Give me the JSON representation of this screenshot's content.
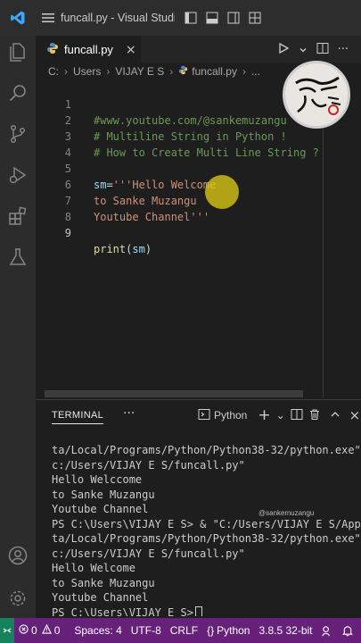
{
  "titlebar": {
    "app_icon": "vscode-logo-icon",
    "menu_icon": "hamburger-menu-icon",
    "title": "funcall.py - Visual Studi..."
  },
  "activity_bar": {
    "items": [
      "explorer-icon",
      "search-icon",
      "source-control-icon",
      "run-debug-icon",
      "extensions-icon",
      "testing-icon"
    ],
    "bottom": [
      "accounts-icon",
      "manage-gear-icon"
    ]
  },
  "tab": {
    "icon": "python-file-icon",
    "label": "funcall.py",
    "close": "×"
  },
  "breadcrumb": {
    "parts": [
      "C:",
      "Users",
      "VIJAY E S",
      "funcall.py",
      "..."
    ]
  },
  "editor": {
    "lines": [
      {
        "num": "1",
        "text": "#www.youtube.com/@sankemuzangu"
      },
      {
        "num": "2",
        "text": "# Multiline String in Python !"
      },
      {
        "num": "3",
        "text": "# How to Create Multi Line String ?"
      },
      {
        "num": "4",
        "text": ""
      },
      {
        "num": "5",
        "var": "sm",
        "op": "=",
        "str": "'''Hello Welcome"
      },
      {
        "num": "6",
        "str": "to Sanke Muzangu"
      },
      {
        "num": "7",
        "str": "Youtube Channel'''"
      },
      {
        "num": "8",
        "text": ""
      },
      {
        "num": "9",
        "func": "print",
        "open": "(",
        "arg": "sm",
        "close": ")"
      }
    ]
  },
  "panel": {
    "title": "TERMINAL",
    "more": "···",
    "profile": "Python",
    "add": "+",
    "chevron": "⌄",
    "lines": [
      "ta/Local/Programs/Python/Python38-32/python.exe\" \"",
      "c:/Users/VIJAY E S/funcall.py\"",
      "Hello Welccome",
      "to Sanke Muzangu",
      "Youtube Channel",
      "PS C:\\Users\\VIJAY E S> & \"C:/Users/VIJAY E S/AppDa",
      "ta/Local/Programs/Python/Python38-32/python.exe\" \"",
      "c:/Users/VIJAY E S/funcall.py\"",
      "Hello Welcome",
      "to Sanke Muzangu",
      "Youtube Channel",
      "PS C:\\Users\\VIJAY E S>"
    ],
    "watermark": "@sankemuzangu"
  },
  "statusbar": {
    "errors": "0",
    "warnings": "0",
    "spaces": "Spaces: 4",
    "encoding": "UTF-8",
    "eol": "CRLF",
    "language": "Python",
    "interpreter": "3.8.5 32-bit"
  },
  "colors": {
    "statusbar": "#68217a",
    "comment": "#6a9955",
    "string": "#ce9178",
    "variable": "#9cdcfe",
    "function": "#dcdcaa"
  }
}
